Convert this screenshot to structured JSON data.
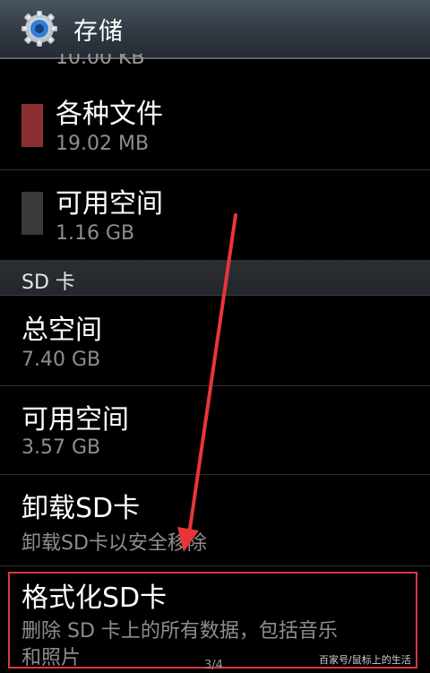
{
  "header": {
    "title": "存储",
    "icon": "gear-icon"
  },
  "partial_item": {
    "sub": "10.00 KB"
  },
  "items": [
    {
      "title": "各种文件",
      "sub": "19.02 MB",
      "color": "#8a2f33"
    },
    {
      "title": "可用空间",
      "sub": "1.16 GB",
      "color": "#3a3a3a"
    }
  ],
  "section": {
    "label": "SD 卡"
  },
  "sd_items": [
    {
      "title": "总空间",
      "sub": "7.40 GB"
    },
    {
      "title": "可用空间",
      "sub": "3.57 GB"
    },
    {
      "title": "卸载SD卡",
      "sub": "卸载SD卡以安全移除"
    },
    {
      "title": "格式化SD卡",
      "sub": "删除 SD 卡上的所有数据，包括音乐",
      "sub2": "和照片"
    }
  ],
  "footer": {
    "page": "3/4",
    "watermark": "百家号/鼠标上的生活"
  },
  "colors": {
    "accent": "#2f80d8",
    "highlight": "#d83a3a",
    "arrow": "#e8353a"
  }
}
